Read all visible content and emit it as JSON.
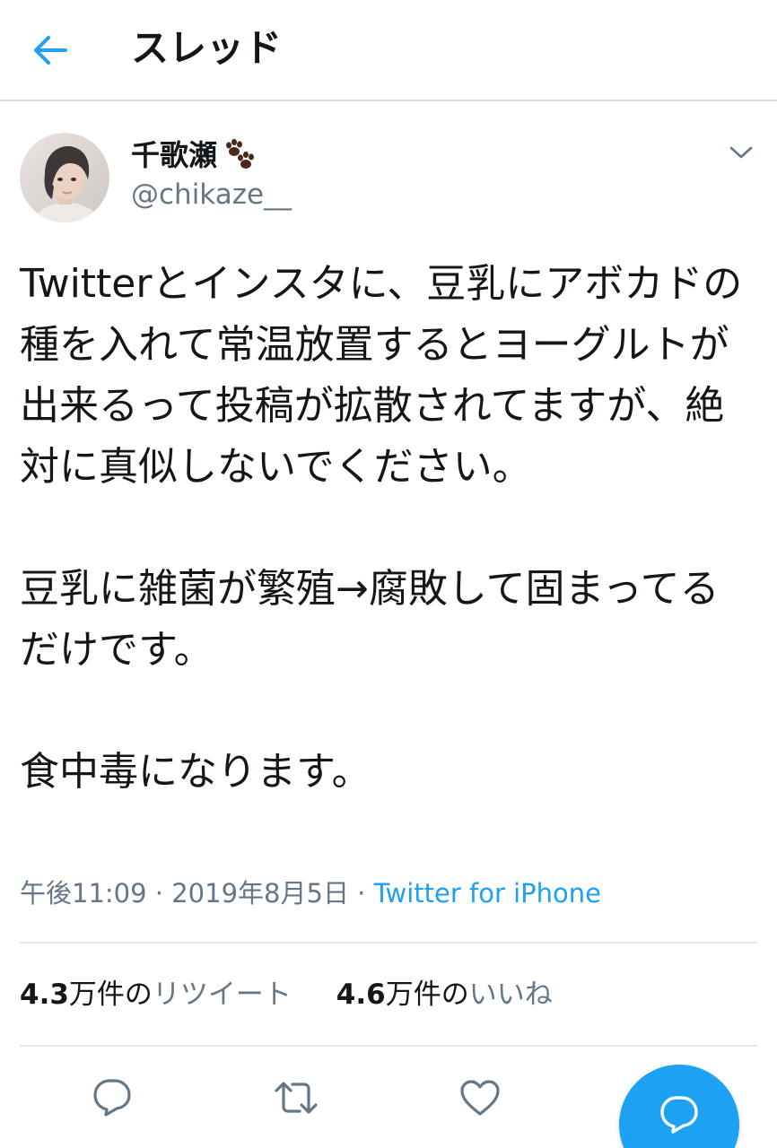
{
  "header": {
    "title": "スレッド",
    "back_icon": "arrow-left-icon"
  },
  "tweet": {
    "author": {
      "display_name": "千歌瀬",
      "name_emoji": "paw-prints-icon",
      "handle": "@chikaze__"
    },
    "text": {
      "paragraph_1": "Twitterとインスタに、豆乳にアボカドの種を入れて常温放置するとヨーグルトが出来るって投稿が拡散されてますが、絶対に真似しないでください。",
      "paragraph_2": "豆乳に雑菌が繁殖→腐敗して固まってるだけです。",
      "paragraph_3": "食中毒になります。"
    },
    "meta": {
      "time": "午後11:09",
      "sep1": " · ",
      "date": "2019年8月5日",
      "sep2": " · ",
      "source": "Twitter for iPhone"
    },
    "stats": {
      "retweets": {
        "num": "4.3",
        "unit": "万件の",
        "label": "リツイート"
      },
      "likes": {
        "num": "4.6",
        "unit": "万件の",
        "label": "いいね"
      }
    }
  },
  "actions": [
    "reply-icon",
    "retweet-icon",
    "like-icon",
    "compose-reply-icon"
  ],
  "colors": {
    "accent": "#1da1f2",
    "secondary_text": "#657786",
    "divider": "#e1e8ed"
  }
}
